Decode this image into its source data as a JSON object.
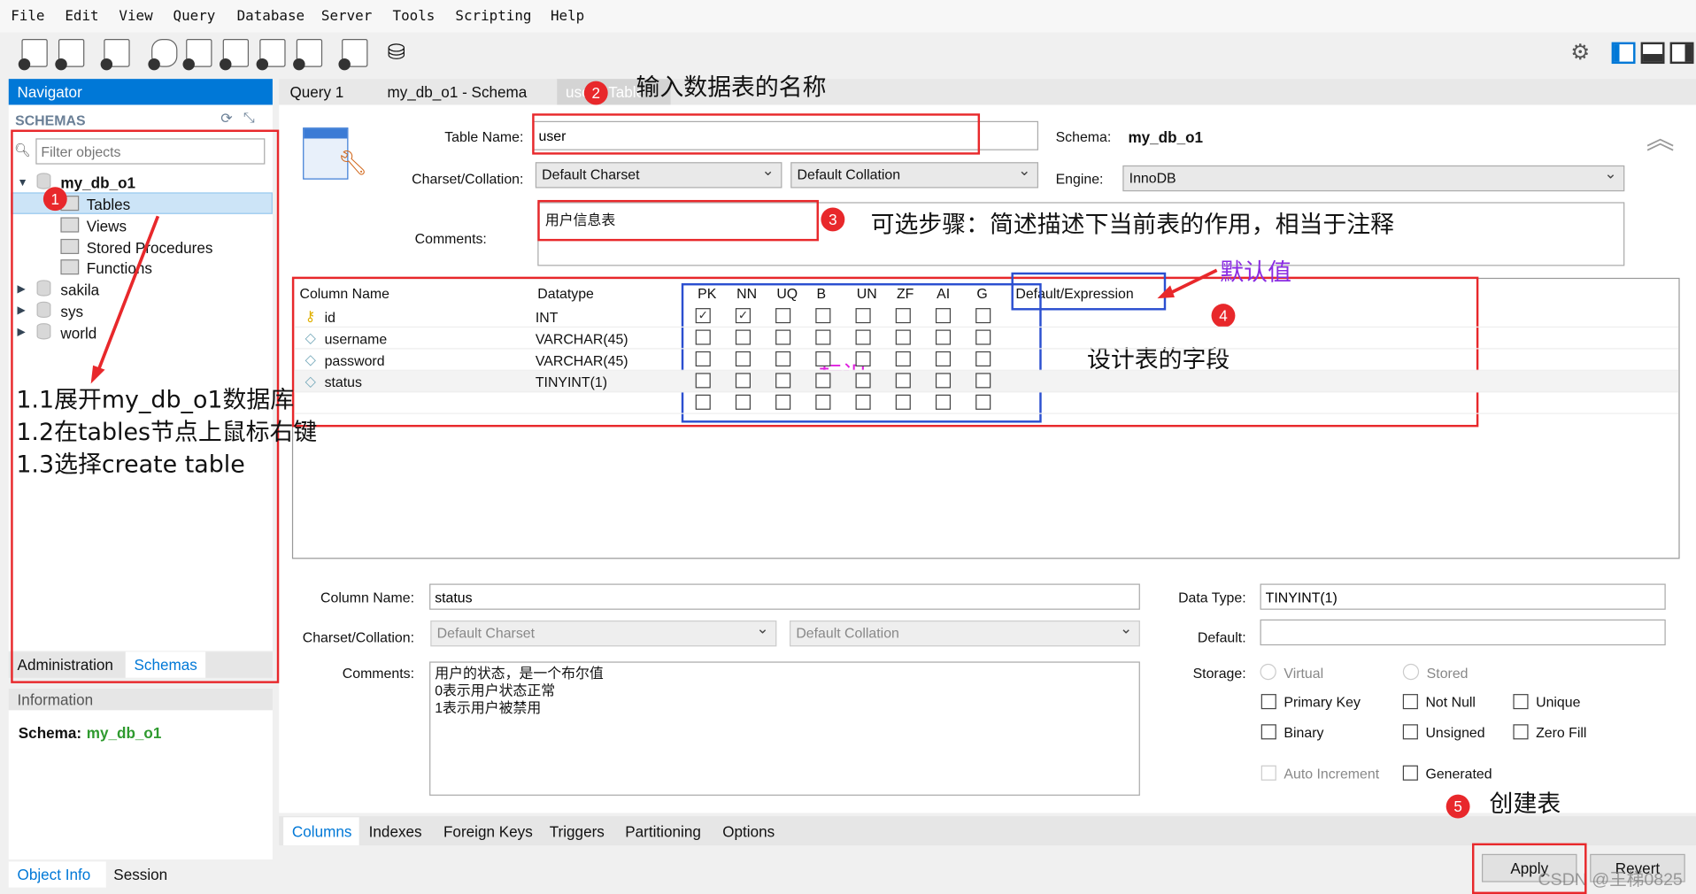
{
  "menu": [
    "File",
    "Edit",
    "View",
    "Query",
    "Database",
    "Server",
    "Tools",
    "Scripting",
    "Help"
  ],
  "toolbar_icons": [
    "new-sql-tab-icon",
    "open-sql-file-icon",
    "inspector-icon",
    "create-schema-icon",
    "create-table-icon",
    "create-view-icon",
    "create-procedure-icon",
    "create-function-icon",
    "search-table-data-icon",
    "reconnect-icon"
  ],
  "navigator": {
    "title": "Navigator",
    "schemas_label": "SCHEMAS",
    "filter_placeholder": "Filter objects",
    "tree": {
      "db": "my_db_o1",
      "children": [
        "Tables",
        "Views",
        "Stored Procedures",
        "Functions"
      ],
      "others": [
        "sakila",
        "sys",
        "world"
      ]
    },
    "tabs": [
      "Administration",
      "Schemas"
    ],
    "info_title": "Information",
    "schema_label": "Schema:",
    "schema_value": "my_db_o1",
    "bottom_tabs": [
      "Object Info",
      "Session"
    ]
  },
  "editor_tabs": [
    "Query 1",
    "my_db_o1 - Schema",
    "user - Table"
  ],
  "table": {
    "name_label": "Table Name:",
    "name": "user",
    "schema_label": "Schema:",
    "schema": "my_db_o1",
    "charset_label": "Charset/Collation:",
    "charset": "Default Charset",
    "collation": "Default Collation",
    "engine_label": "Engine:",
    "engine": "InnoDB",
    "comments_label": "Comments:",
    "comments": "用户信息表"
  },
  "grid": {
    "headers": [
      "Column Name",
      "Datatype",
      "PK",
      "NN",
      "UQ",
      "B",
      "UN",
      "ZF",
      "AI",
      "G",
      "Default/Expression"
    ],
    "rows": [
      {
        "name": "id",
        "type": "INT",
        "flags": [
          true,
          true,
          false,
          false,
          false,
          false,
          false,
          false
        ],
        "key": true
      },
      {
        "name": "username",
        "type": "VARCHAR(45)",
        "flags": [
          false,
          false,
          false,
          false,
          false,
          false,
          false,
          false
        ],
        "key": false
      },
      {
        "name": "password",
        "type": "VARCHAR(45)",
        "flags": [
          false,
          false,
          false,
          false,
          false,
          false,
          false,
          false
        ],
        "key": false
      },
      {
        "name": "status",
        "type": "TINYINT(1)",
        "flags": [
          false,
          false,
          false,
          false,
          false,
          false,
          false,
          false
        ],
        "key": false
      },
      {
        "name": "",
        "type": "",
        "flags": [
          false,
          false,
          false,
          false,
          false,
          false,
          false,
          false
        ],
        "key": false
      }
    ]
  },
  "detail": {
    "colname_label": "Column Name:",
    "colname": "status",
    "charset_label": "Charset/Collation:",
    "charset": "Default Charset",
    "collation": "Default Collation",
    "comments_label": "Comments:",
    "comments": "用户的状态，是一个布尔值\n0表示用户状态正常\n1表示用户被禁用",
    "datatype_label": "Data Type:",
    "datatype": "TINYINT(1)",
    "default_label": "Default:",
    "default": "",
    "storage_label": "Storage:",
    "virtual": "Virtual",
    "stored": "Stored",
    "checks": [
      "Primary Key",
      "Not Null",
      "Unique",
      "Binary",
      "Unsigned",
      "Zero Fill",
      "Auto Increment",
      "Generated"
    ]
  },
  "bottom_tabs": [
    "Columns",
    "Indexes",
    "Foreign Keys",
    "Triggers",
    "Partitioning",
    "Options"
  ],
  "buttons": {
    "apply": "Apply",
    "revert": "Revert"
  },
  "annotations": {
    "n1": "1",
    "n2": "2",
    "n3": "3",
    "n4": "4",
    "n5": "5",
    "step1_1": "1.1展开my_db_o1数据库",
    "step1_2": "1.2在tables节点上鼠标右键",
    "step1_3": "1.3选择create table",
    "name_hint": "输入数据表的名称",
    "comment_hint": "可选步骤：简述描述下当前表的作用，相当于注释",
    "default_hint": "默认值",
    "fields_hint": "设计表的字段",
    "flags_hint": "标识",
    "create_hint": "创建表"
  },
  "watermark": "CSDN @王梯0825",
  "colors": {
    "accent": "#0078d7",
    "annotation_red": "#e8282b",
    "annotation_blue": "#2b4fd0",
    "purple": "#8a2be2",
    "magenta": "#e020e0",
    "green": "#2e9a2e"
  }
}
